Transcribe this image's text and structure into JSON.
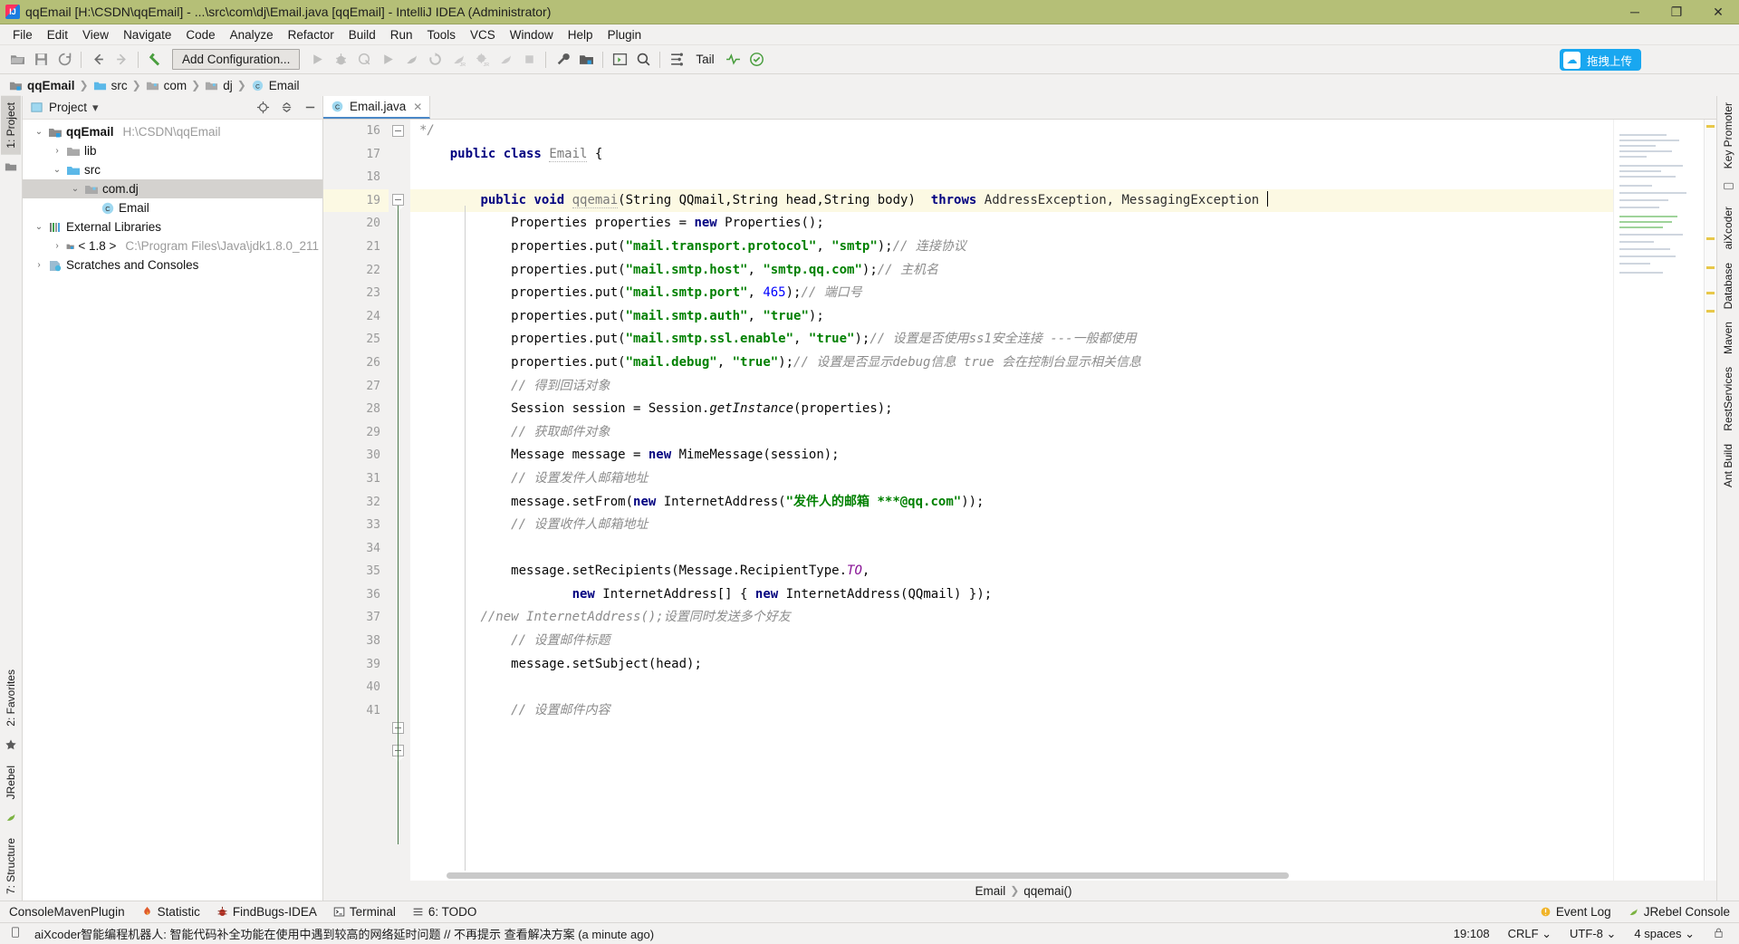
{
  "window": {
    "title": "qqEmail [H:\\CSDN\\qqEmail] - ...\\src\\com\\dj\\Email.java [qqEmail] - IntelliJ IDEA (Administrator)",
    "app_icon": "IJ",
    "minimize": "─",
    "maximize": "❐",
    "close": "✕"
  },
  "menu": {
    "items": [
      {
        "label": "File"
      },
      {
        "label": "Edit"
      },
      {
        "label": "View"
      },
      {
        "label": "Navigate"
      },
      {
        "label": "Code"
      },
      {
        "label": "Analyze"
      },
      {
        "label": "Refactor"
      },
      {
        "label": "Build"
      },
      {
        "label": "Run"
      },
      {
        "label": "Tools"
      },
      {
        "label": "VCS"
      },
      {
        "label": "Window"
      },
      {
        "label": "Help"
      },
      {
        "label": "Plugin"
      }
    ]
  },
  "toolbar": {
    "run_config": "Add Configuration...",
    "tail_label": "Tail",
    "upload_label": "拖拽上传",
    "upload_icon": "☁",
    "icons": [
      "open-folder-icon",
      "save-all-icon",
      "sync-icon",
      "back-icon",
      "forward-icon",
      "undo-icon"
    ],
    "run_icons": [
      "run-icon",
      "debug-icon",
      "run-with-coverage-icon",
      "run-alt-icon",
      "profile-icon",
      "rerun-icon",
      "jrebel-run-icon",
      "jrebel-debug-icon",
      "jrebel-profile-icon",
      "stop-icon"
    ],
    "right_icons": [
      "wrench-settings-icon",
      "project-structure-icon",
      "terminal-icon",
      "search-everywhere-icon",
      "aixcoder-icon"
    ],
    "extra_icons": [
      "heartbeat-icon",
      "check-circle-icon"
    ]
  },
  "breadcrumb": {
    "items": [
      {
        "label": "qqEmail",
        "icon": "module-icon",
        "bold": true
      },
      {
        "label": "src",
        "icon": "source-folder-icon",
        "bold": false
      },
      {
        "label": "com",
        "icon": "package-icon",
        "bold": false
      },
      {
        "label": "dj",
        "icon": "package-icon",
        "bold": false
      },
      {
        "label": "Email",
        "icon": "class-icon",
        "bold": false
      }
    ],
    "separator": "❯"
  },
  "left_strip": {
    "project_tab": "1: Project",
    "favorites_tab": "2: Favorites",
    "structure_tab": "7: Structure",
    "jrebel_tab": "JRebel"
  },
  "right_strip": {
    "tabs": [
      "Key Promoter",
      "aiXcoder",
      "Database",
      "Maven",
      "RestServices",
      "Ant Build"
    ]
  },
  "project_panel": {
    "title": "Project",
    "dropdown_icon": "▾",
    "locate_icon": "locate-target-icon",
    "collapse_icon": "collapse-all-icon",
    "hide_icon": "hide-panel-icon",
    "tree": [
      {
        "label": "qqEmail",
        "path": "H:\\CSDN\\qqEmail",
        "icon": "module-icon",
        "indent": 0,
        "arrow": "⌄",
        "bold": true,
        "selected": false
      },
      {
        "label": "lib",
        "path": "",
        "icon": "folder-icon",
        "indent": 1,
        "arrow": "›",
        "bold": false,
        "selected": false
      },
      {
        "label": "src",
        "path": "",
        "icon": "source-folder-icon",
        "indent": 1,
        "arrow": "⌄",
        "bold": false,
        "selected": false
      },
      {
        "label": "com.dj",
        "path": "",
        "icon": "package-icon",
        "indent": 2,
        "arrow": "⌄",
        "bold": false,
        "selected": true
      },
      {
        "label": "Email",
        "path": "",
        "icon": "class-icon",
        "indent": 3,
        "arrow": "",
        "bold": false,
        "selected": false
      },
      {
        "label": "External Libraries",
        "path": "",
        "icon": "libraries-icon",
        "indent": 0,
        "arrow": "⌄",
        "bold": false,
        "selected": false
      },
      {
        "label": "< 1.8 >",
        "path": "C:\\Program Files\\Java\\jdk1.8.0_211",
        "icon": "jdk-icon",
        "indent": 1,
        "arrow": "›",
        "bold": false,
        "selected": false
      },
      {
        "label": "Scratches and Consoles",
        "path": "",
        "icon": "scratches-icon",
        "indent": 0,
        "arrow": "›",
        "bold": false,
        "selected": false
      }
    ]
  },
  "editor": {
    "tab": {
      "label": "Email.java",
      "icon": "class-icon",
      "close": "✕"
    },
    "first_line_number": 16,
    "current_line": 19,
    "lines": [
      {
        "n": 16,
        "fold": "end"
      },
      {
        "n": 17
      },
      {
        "n": 18
      },
      {
        "n": 19,
        "fold": "start"
      },
      {
        "n": 20
      },
      {
        "n": 21
      },
      {
        "n": 22
      },
      {
        "n": 23
      },
      {
        "n": 24
      },
      {
        "n": 25
      },
      {
        "n": 26
      },
      {
        "n": 27
      },
      {
        "n": 28
      },
      {
        "n": 29
      },
      {
        "n": 30
      },
      {
        "n": 31
      },
      {
        "n": 32
      },
      {
        "n": 33
      },
      {
        "n": 34
      },
      {
        "n": 35
      },
      {
        "n": 36
      },
      {
        "n": 37,
        "fold": "start"
      },
      {
        "n": 38,
        "fold": "start"
      },
      {
        "n": 39
      },
      {
        "n": 40
      },
      {
        "n": 41
      }
    ],
    "code": {
      "l16": "*/",
      "l17_kw": "public class",
      "l17_cls": "Email",
      "l17_brace": "{",
      "l19_kw1": "public void",
      "l19_name": "qqemai",
      "l19_params": "(String QQmail,String head,String body)",
      "l19_throws": "throws",
      "l19_exc": "AddressException, MessagingException",
      "l20": "Properties properties = ",
      "l20_kw": "new",
      "l20_rest": " Properties();",
      "l21_a": "properties.put(",
      "l21_s1": "\"mail.transport.protocol\"",
      "l21_b": ", ",
      "l21_s2": "\"smtp\"",
      "l21_c": ");",
      "l21_cmt": "// 连接协议",
      "l22_s1": "\"mail.smtp.host\"",
      "l22_s2": "\"smtp.qq.com\"",
      "l22_cmt": "// 主机名",
      "l23_s1": "\"mail.smtp.port\"",
      "l23_num": "465",
      "l23_cmt": "// 端口号",
      "l24_s1": "\"mail.smtp.auth\"",
      "l24_s2": "\"true\"",
      "l25_s1": "\"mail.smtp.ssl.enable\"",
      "l25_s2": "\"true\"",
      "l25_cmt": "// 设置是否使用ss1安全连接 ---一般都使用",
      "l26_s1": "\"mail.debug\"",
      "l26_s2": "\"true\"",
      "l26_cmt": "// 设置是否显示debug信息 true 会在控制台显示相关信息",
      "l27_cmt": "// 得到回话对象",
      "l28_a": "Session session = Session.",
      "l28_m": "getInstance",
      "l28_b": "(properties);",
      "l29_cmt": "// 获取邮件对象",
      "l30_a": "Message message = ",
      "l30_kw": "new",
      "l30_b": " MimeMessage(session);",
      "l31_cmt": "// 设置发件人邮箱地址",
      "l32_a": "message.setFrom(",
      "l32_kw": "new",
      "l32_b": " InternetAddress(",
      "l32_s": "\"发件人的邮箱 ***@qq.com\"",
      "l32_c": "));",
      "l33_cmt": "// 设置收件人邮箱地址",
      "l35_a": "message.setRecipients(Message.RecipientType.",
      "l35_fld": "TO",
      "l35_b": ",",
      "l36_kw1": "new",
      "l36_a": " InternetAddress[] { ",
      "l36_kw2": "new",
      "l36_b": " InternetAddress(QQmail) });",
      "l37_cmt": "//new InternetAddress();设置同时发送多个好友",
      "l38_cmt": "// 设置邮件标题",
      "l39": "message.setSubject(head);",
      "l41_cmt": "// 设置邮件内容"
    },
    "nav_breadcrumb": {
      "class": "Email",
      "method": "qqemai()",
      "separator": "❯"
    }
  },
  "bottom_bar": {
    "items": [
      {
        "label": "ConsoleMavenPlugin",
        "icon": ""
      },
      {
        "label": "Statistic",
        "icon": "statistic-icon"
      },
      {
        "label": "FindBugs-IDEA",
        "icon": "findbugs-icon"
      },
      {
        "label": "Terminal",
        "icon": "terminal-icon"
      },
      {
        "label": "6: TODO",
        "icon": "todo-icon"
      }
    ],
    "right_items": [
      {
        "label": "Event Log",
        "icon": "event-log-icon"
      },
      {
        "label": "JRebel Console",
        "icon": "jrebel-icon"
      }
    ]
  },
  "status_bar": {
    "message_icon": "notification-icon",
    "message": "aiXcoder智能编程机器人: 智能代码补全功能在使用中遇到较高的网络延时问题 // 不再提示 查看解决方案 (a minute ago)",
    "caret_position": "19:108",
    "line_separator": "CRLF",
    "encoding": "UTF-8",
    "indent": "4 spaces",
    "lock_icon": "lock-icon",
    "chevron": "⌄"
  },
  "colors": {
    "title_bg": "#b5bf77",
    "accent": "#19a7f0",
    "panel_bg": "#f2f1f0",
    "selection": "#d4d2cf",
    "current_line": "#fcf9e3",
    "keyword": "#000080",
    "string": "#008000",
    "comment": "#8c8c8c",
    "number": "#0000ff",
    "field": "#871094"
  }
}
